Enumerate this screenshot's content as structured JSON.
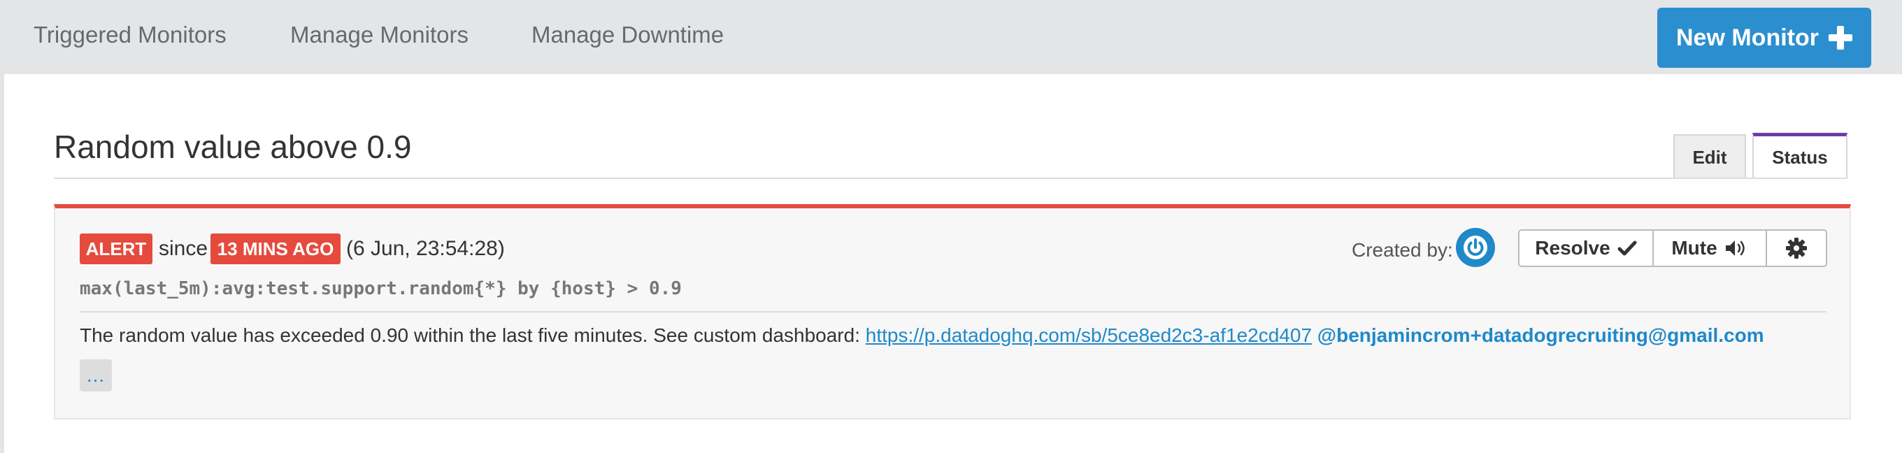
{
  "nav": {
    "tabs": [
      {
        "label": "Triggered Monitors"
      },
      {
        "label": "Manage Monitors"
      },
      {
        "label": "Manage Downtime"
      }
    ],
    "new_monitor_label": "New Monitor",
    "new_monitor_icon": "plus-icon"
  },
  "monitor": {
    "title": "Random value above 0.9",
    "tabs": {
      "edit": "Edit",
      "status": "Status"
    },
    "status_badge": "ALERT",
    "since_text": "since",
    "age_badge": "13 MINS AGO",
    "timestamp": "(6 Jun, 23:54:28)",
    "query": "max(last_5m):avg:test.support.random{*} by {host} > 0.9",
    "created_by_label": "Created by:",
    "actions": {
      "resolve_label": "Resolve",
      "resolve_icon": "checkmark-icon",
      "mute_label": "Mute",
      "mute_icon": "speaker-icon",
      "settings_icon": "gear-icon"
    },
    "message": {
      "text": "The random value has exceeded 0.90 within the last five minutes. See custom dashboard:",
      "link": "https://p.datadoghq.com/sb/5ce8ed2c3-af1e2cd407",
      "mention": "@benjamincrom+datadogrecruiting@gmail.com"
    },
    "expand_label": "..."
  },
  "colors": {
    "nav_bg": "#e4e5e7",
    "brand_blue": "#2b8fcf",
    "alert_red": "#e54b3d",
    "status_tab_accent": "#6b3fa7",
    "link_blue": "#1f89c9"
  }
}
